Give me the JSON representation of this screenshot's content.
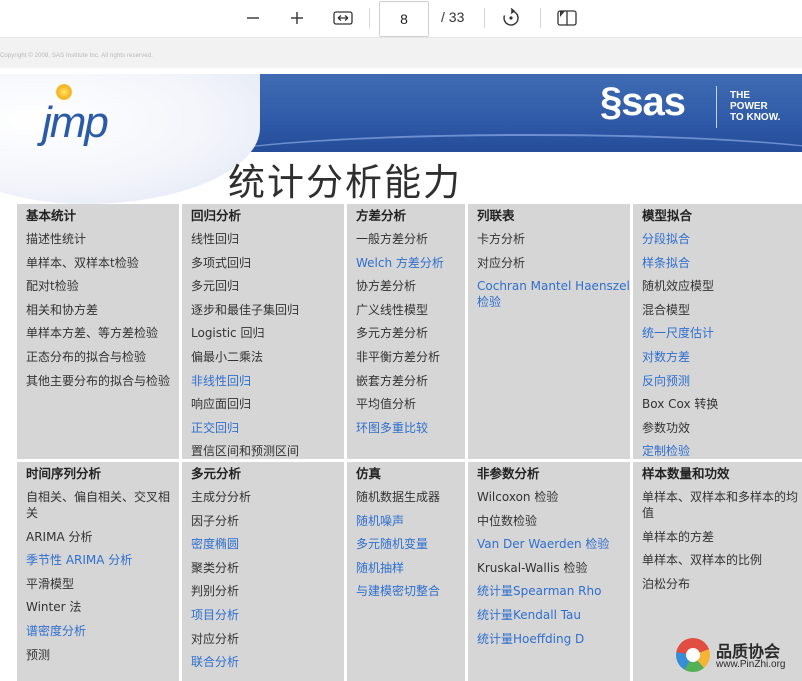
{
  "toolbar": {
    "page_number": "8",
    "page_total": "/ 33",
    "icons": [
      "minus-icon",
      "plus-icon",
      "fit-width-icon",
      "rotate-icon",
      "page-view-icon"
    ]
  },
  "copyright": "Copyright © 2008, SAS Institute Inc. All rights reserved.",
  "banner": {
    "jmp_logo": "jmp",
    "sas_logo": "§sas",
    "sas_tagline": [
      "THE",
      "POWER",
      "TO KNOW."
    ],
    "title": "统计分析能力",
    "colors": {
      "band": "#2f5aa8",
      "link": "#2f6fcf",
      "cell": "#d6d6d6"
    }
  },
  "table": {
    "rows": [
      {
        "cells": [
          {
            "header": "基本统计",
            "items": [
              {
                "text": "描述性统计",
                "link": false
              },
              {
                "text": "单样本、双样本t检验",
                "link": false
              },
              {
                "text": "配对t检验",
                "link": false
              },
              {
                "text": "相关和协方差",
                "link": false
              },
              {
                "text": "单样本方差、等方差检验",
                "link": false
              },
              {
                "text": "正态分布的拟合与检验",
                "link": false
              },
              {
                "text": "其他主要分布的拟合与检验",
                "link": false
              }
            ]
          },
          {
            "header": "回归分析",
            "items": [
              {
                "text": "线性回归",
                "link": false
              },
              {
                "text": "多项式回归",
                "link": false
              },
              {
                "text": "多元回归",
                "link": false
              },
              {
                "text": "逐步和最佳子集回归",
                "link": false
              },
              {
                "text": "Logistic 回归",
                "link": false
              },
              {
                "text": "偏最小二乘法",
                "link": false
              },
              {
                "text": "非线性回归",
                "link": true
              },
              {
                "text": "响应面回归",
                "link": false
              },
              {
                "text": "正交回归",
                "link": true
              },
              {
                "text": "置信区间和预测区间",
                "link": false
              }
            ]
          },
          {
            "header": "方差分析",
            "items": [
              {
                "text": "一般方差分析",
                "link": false
              },
              {
                "text": "Welch 方差分析",
                "link": true
              },
              {
                "text": "协方差分析",
                "link": false
              },
              {
                "text": "广义线性模型",
                "link": false
              },
              {
                "text": "多元方差分析",
                "link": false
              },
              {
                "text": "非平衡方差分析",
                "link": false
              },
              {
                "text": "嵌套方差分析",
                "link": false
              },
              {
                "text": "平均值分析",
                "link": false
              },
              {
                "text": "环图多重比较",
                "link": true
              }
            ]
          },
          {
            "header": "列联表",
            "items": [
              {
                "text": "卡方分析",
                "link": false
              },
              {
                "text": "对应分析",
                "link": false
              },
              {
                "text": "Cochran Mantel Haenszel 检验",
                "link": true
              }
            ]
          },
          {
            "header": "模型拟合",
            "items": [
              {
                "text": "分段拟合",
                "link": true
              },
              {
                "text": "样条拟合",
                "link": true
              },
              {
                "text": "随机效应模型",
                "link": false
              },
              {
                "text": "混合模型",
                "link": false
              },
              {
                "text": "统一尺度估计",
                "link": true
              },
              {
                "text": "对数方差",
                "link": true
              },
              {
                "text": "反向预测",
                "link": true
              },
              {
                "text": "Box Cox 转换",
                "link": false
              },
              {
                "text": "参数功效",
                "link": false
              },
              {
                "text": "定制检验",
                "link": true
              }
            ]
          }
        ]
      },
      {
        "cells": [
          {
            "header": "时间序列分析",
            "items": [
              {
                "text": "自相关、偏自相关、交叉相关",
                "link": false
              },
              {
                "text": "ARIMA 分析",
                "link": false
              },
              {
                "text": "季节性 ARIMA 分析",
                "link": true
              },
              {
                "text": "平滑模型",
                "link": false
              },
              {
                "text": "Winter 法",
                "link": false
              },
              {
                "text": "谱密度分析",
                "link": true
              },
              {
                "text": "预测",
                "link": false
              }
            ]
          },
          {
            "header": "多元分析",
            "items": [
              {
                "text": "主成分分析",
                "link": false
              },
              {
                "text": "因子分析",
                "link": false
              },
              {
                "text": "密度椭圆",
                "link": true
              },
              {
                "text": "聚类分析",
                "link": false
              },
              {
                "text": "判别分析",
                "link": false
              },
              {
                "text": "项目分析",
                "link": true
              },
              {
                "text": "对应分析",
                "link": false
              },
              {
                "text": "联合分析",
                "link": true
              }
            ]
          },
          {
            "header": "仿真",
            "items": [
              {
                "text": "随机数据生成器",
                "link": false
              },
              {
                "text": "随机噪声",
                "link": true
              },
              {
                "text": "多元随机变量",
                "link": true
              },
              {
                "text": "随机抽样",
                "link": true
              },
              {
                "text": "与建模密切整合",
                "link": true
              }
            ]
          },
          {
            "header": "非参数分析",
            "items": [
              {
                "text": "Wilcoxon 检验",
                "link": false
              },
              {
                "text": "中位数检验",
                "link": false
              },
              {
                "text": "Van Der Waerden 检验",
                "link": true
              },
              {
                "text": "Kruskal-Wallis 检验",
                "link": false
              },
              {
                "text": "统计量Spearman Rho",
                "link": true
              },
              {
                "text": "统计量Kendall Tau",
                "link": true
              },
              {
                "text": "统计量Hoeffding D",
                "link": true
              }
            ]
          },
          {
            "header": "样本数量和功效",
            "items": [
              {
                "text": "单样本、双样本和多样本的均值",
                "link": false
              },
              {
                "text": "单样本的方差",
                "link": false
              },
              {
                "text": "单样本、双样本的比例",
                "link": false
              },
              {
                "text": "泊松分布",
                "link": false
              }
            ]
          }
        ]
      }
    ]
  },
  "watermark": {
    "title": "品质协会",
    "url": "www.PinZhi.org"
  }
}
